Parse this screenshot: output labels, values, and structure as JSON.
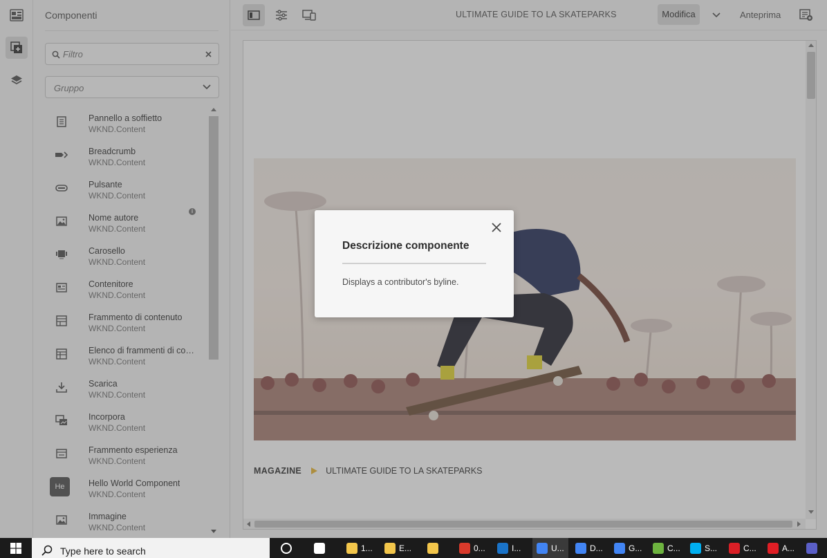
{
  "rail": {
    "items": [
      {
        "name": "site-icon"
      },
      {
        "name": "components-icon"
      },
      {
        "name": "layers-icon"
      }
    ]
  },
  "panel": {
    "title": "Componenti",
    "search_placeholder": "Filtro",
    "group_select": "Gruppo",
    "components": [
      {
        "name": "Pannello a soffietto",
        "group": "WKND.Content",
        "icon": "accordion-icon"
      },
      {
        "name": "Breadcrumb",
        "group": "WKND.Content",
        "icon": "breadcrumb-icon"
      },
      {
        "name": "Pulsante",
        "group": "WKND.Content",
        "icon": "button-icon"
      },
      {
        "name": "Nome autore",
        "group": "WKND.Content",
        "icon": "image-icon",
        "info": true
      },
      {
        "name": "Carosello",
        "group": "WKND.Content",
        "icon": "carousel-icon"
      },
      {
        "name": "Contenitore",
        "group": "WKND.Content",
        "icon": "container-icon"
      },
      {
        "name": "Frammento di contenuto",
        "group": "WKND.Content",
        "icon": "content-fragment-icon"
      },
      {
        "name": "Elenco di frammenti di contenuto",
        "group": "WKND.Content",
        "icon": "content-fragment-list-icon"
      },
      {
        "name": "Scarica",
        "group": "WKND.Content",
        "icon": "download-icon"
      },
      {
        "name": "Incorpora",
        "group": "WKND.Content",
        "icon": "embed-icon"
      },
      {
        "name": "Frammento esperienza",
        "group": "WKND.Content",
        "icon": "experience-fragment-icon"
      },
      {
        "name": "Hello World Component",
        "group": "WKND.Content",
        "icon": "he-badge",
        "badge": "He"
      },
      {
        "name": "Immagine",
        "group": "WKND.Content",
        "icon": "image-icon"
      }
    ]
  },
  "topbar": {
    "page_title": "ULTIMATE GUIDE TO LA SKATEPARKS",
    "mode": "Modifica",
    "preview": "Anteprima"
  },
  "canvas": {
    "breadcrumb": {
      "root": "MAGAZINE",
      "current": "ULTIMATE GUIDE TO LA SKATEPARKS"
    }
  },
  "dialog": {
    "title": "Descrizione componente",
    "body": "Displays a contributor's byline."
  },
  "taskbar": {
    "search_placeholder": "Type here to search",
    "apps": [
      {
        "label": "",
        "icon": "cortana-icon",
        "color": "#ffffff"
      },
      {
        "label": "",
        "icon": "task-view-icon",
        "color": "#ffffff"
      },
      {
        "label": "1...",
        "icon": "folder-icon",
        "color": "#f3c64b"
      },
      {
        "label": "E...",
        "icon": "folder-icon",
        "color": "#f3c64b"
      },
      {
        "label": "",
        "icon": "folder-icon",
        "color": "#f3c64b"
      },
      {
        "label": "0...",
        "icon": "app-icon",
        "color": "#d93a2b"
      },
      {
        "label": "I...",
        "icon": "outlook-icon",
        "color": "#1a73c8"
      },
      {
        "label": "U...",
        "icon": "chrome-icon",
        "color": "#4285f4"
      },
      {
        "label": "D...",
        "icon": "chrome-icon",
        "color": "#4285f4"
      },
      {
        "label": "G...",
        "icon": "chrome-icon",
        "color": "#4285f4"
      },
      {
        "label": "C...",
        "icon": "editor-icon",
        "color": "#6db33f"
      },
      {
        "label": "S...",
        "icon": "skype-icon",
        "color": "#00aff0"
      },
      {
        "label": "C...",
        "icon": "creative-cloud-icon",
        "color": "#da1f26"
      },
      {
        "label": "A...",
        "icon": "acrobat-icon",
        "color": "#e01e25"
      },
      {
        "label": "",
        "icon": "teams-icon",
        "color": "#5b5fc7"
      }
    ]
  }
}
